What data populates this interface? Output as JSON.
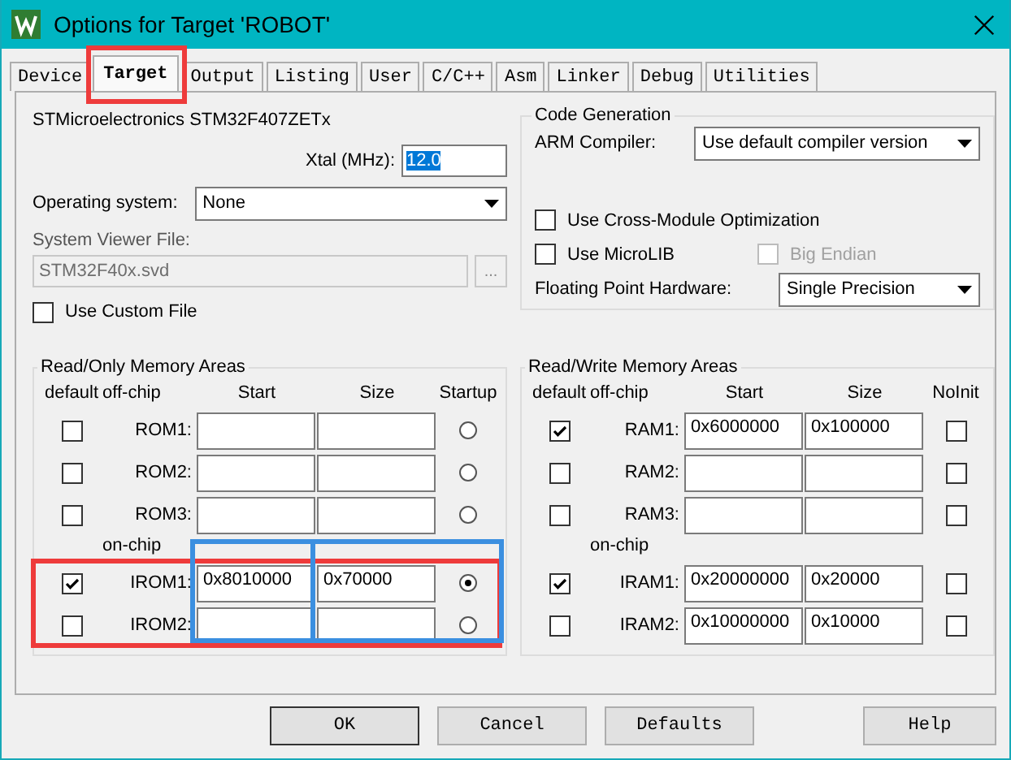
{
  "window": {
    "title": "Options for Target 'ROBOT'"
  },
  "tabs": [
    {
      "label": "Device",
      "selected": false,
      "highlighted": false
    },
    {
      "label": "Target",
      "selected": true,
      "highlighted": true
    },
    {
      "label": "Output",
      "selected": false,
      "highlighted": false
    },
    {
      "label": "Listing",
      "selected": false,
      "highlighted": false
    },
    {
      "label": "User",
      "selected": false,
      "highlighted": false
    },
    {
      "label": "C/C++",
      "selected": false,
      "highlighted": false
    },
    {
      "label": "Asm",
      "selected": false,
      "highlighted": false
    },
    {
      "label": "Linker",
      "selected": false,
      "highlighted": false
    },
    {
      "label": "Debug",
      "selected": false,
      "highlighted": false
    },
    {
      "label": "Utilities",
      "selected": false,
      "highlighted": false
    }
  ],
  "device": "STMicroelectronics STM32F407ZETx",
  "xtal": {
    "label": "Xtal (MHz):",
    "value": "12.0",
    "text_selected": true
  },
  "operating_system": {
    "label": "Operating system:",
    "value": "None"
  },
  "system_viewer_file": {
    "label": "System Viewer File:",
    "value": "STM32F40x.svd",
    "disabled": true,
    "browse": "..."
  },
  "use_custom_file": {
    "label": "Use Custom File",
    "checked": false
  },
  "code_generation": {
    "title": "Code Generation",
    "arm_compiler": {
      "label": "ARM Compiler:",
      "value": "Use default compiler version"
    },
    "options": [
      {
        "label": "Use Cross-Module Optimization",
        "checked": false,
        "disabled": false
      },
      {
        "label": "Use MicroLIB",
        "checked": false,
        "disabled": false
      },
      {
        "label": "Big Endian",
        "checked": false,
        "disabled": true
      }
    ],
    "fpu": {
      "label": "Floating Point Hardware:",
      "value": "Single Precision"
    }
  },
  "read_only_memory": {
    "title": "Read/Only Memory Areas",
    "columns": [
      "default",
      "off-chip",
      "Start",
      "Size",
      "Startup"
    ],
    "rows": [
      {
        "kind": "area",
        "default": false,
        "name": "ROM1:",
        "startup": false
      },
      {
        "kind": "area",
        "default": false,
        "name": "ROM2:",
        "startup": false
      },
      {
        "kind": "area",
        "default": false,
        "name": "ROM3:",
        "startup": false
      },
      {
        "kind": "section",
        "label": "on-chip"
      },
      {
        "kind": "area",
        "default": true,
        "name": "IROM1:",
        "start": "0x8010000",
        "size": "0x70000",
        "startup": true,
        "highlighted": true,
        "start_highlighted": true,
        "size_highlighted": true
      },
      {
        "kind": "area",
        "default": false,
        "name": "IROM2:",
        "startup": false
      }
    ]
  },
  "read_write_memory": {
    "title": "Read/Write Memory Areas",
    "columns": [
      "default",
      "off-chip",
      "Start",
      "Size",
      "NoInit"
    ],
    "rows": [
      {
        "kind": "area",
        "default": true,
        "name": "RAM1:",
        "start": "0x6000000",
        "size": "0x100000",
        "noinit": false
      },
      {
        "kind": "area",
        "default": false,
        "name": "RAM2:",
        "noinit": false
      },
      {
        "kind": "area",
        "default": false,
        "name": "RAM3:",
        "noinit": false
      },
      {
        "kind": "section",
        "label": "on-chip"
      },
      {
        "kind": "area",
        "default": true,
        "name": "IRAM1:",
        "start": "0x20000000",
        "size": "0x20000",
        "noinit": false
      },
      {
        "kind": "area",
        "default": false,
        "name": "IRAM2:",
        "start": "0x10000000",
        "size": "0x10000",
        "noinit": false
      }
    ]
  },
  "buttons": [
    {
      "label": "OK"
    },
    {
      "label": "Cancel"
    },
    {
      "label": "Defaults"
    },
    {
      "label": "Help"
    }
  ]
}
